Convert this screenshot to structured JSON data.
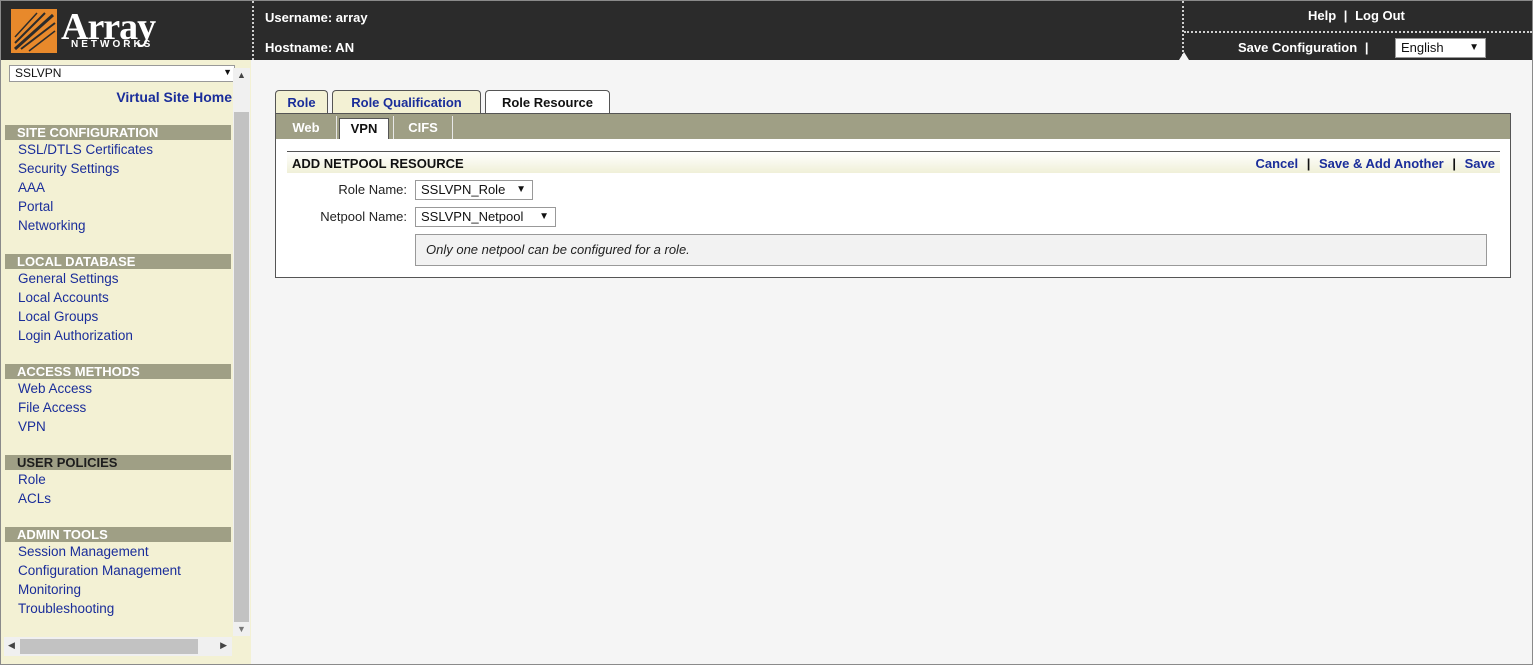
{
  "header": {
    "logo_text": "Array",
    "logo_sub": "NETWORKS",
    "username_label": "Username: array",
    "hostname_label": "Hostname: AN",
    "help_link": "Help",
    "links_sep": "|",
    "logout_link": "Log Out",
    "save_config": "Save Configuration",
    "save_sep": "|",
    "language": "English"
  },
  "sidebar": {
    "site_select": "SSLVPN",
    "virtual_site_home": "Virtual Site Home",
    "sections": [
      {
        "title": "SITE CONFIGURATION",
        "items": [
          "SSL/DTLS Certificates",
          "Security Settings",
          "AAA",
          "Portal",
          "Networking"
        ]
      },
      {
        "title": "LOCAL DATABASE",
        "items": [
          "General Settings",
          "Local Accounts",
          "Local Groups",
          "Login Authorization"
        ]
      },
      {
        "title": "ACCESS METHODS",
        "items": [
          "Web Access",
          "File Access",
          "VPN"
        ]
      },
      {
        "title": "USER POLICIES",
        "items": [
          "Role",
          "ACLs"
        ]
      },
      {
        "title": "ADMIN TOOLS",
        "items": [
          "Session Management",
          "Configuration Management",
          "Monitoring",
          "Troubleshooting"
        ]
      }
    ]
  },
  "main": {
    "tabs": [
      "Role",
      "Role Qualification",
      "Role Resource"
    ],
    "active_tab": "Role Resource",
    "subtabs": [
      "Web",
      "VPN",
      "CIFS"
    ],
    "active_subtab": "VPN",
    "form": {
      "title": "ADD NETPOOL RESOURCE",
      "cancel": "Cancel",
      "save_add": "Save & Add Another",
      "save": "Save",
      "sep": "|",
      "role_name_label": "Role Name:",
      "role_name_value": "SSLVPN_Role",
      "netpool_name_label": "Netpool Name:",
      "netpool_name_value": "SSLVPN_Netpool",
      "note": "Only one netpool can be configured for a role."
    }
  },
  "colors": {
    "header_bg": "#2b2b2b",
    "sidebar_bg": "#f3f1d4",
    "section_bg": "#9f9f85",
    "link": "#1a2d9a",
    "logo_orange": "#e8892b"
  }
}
